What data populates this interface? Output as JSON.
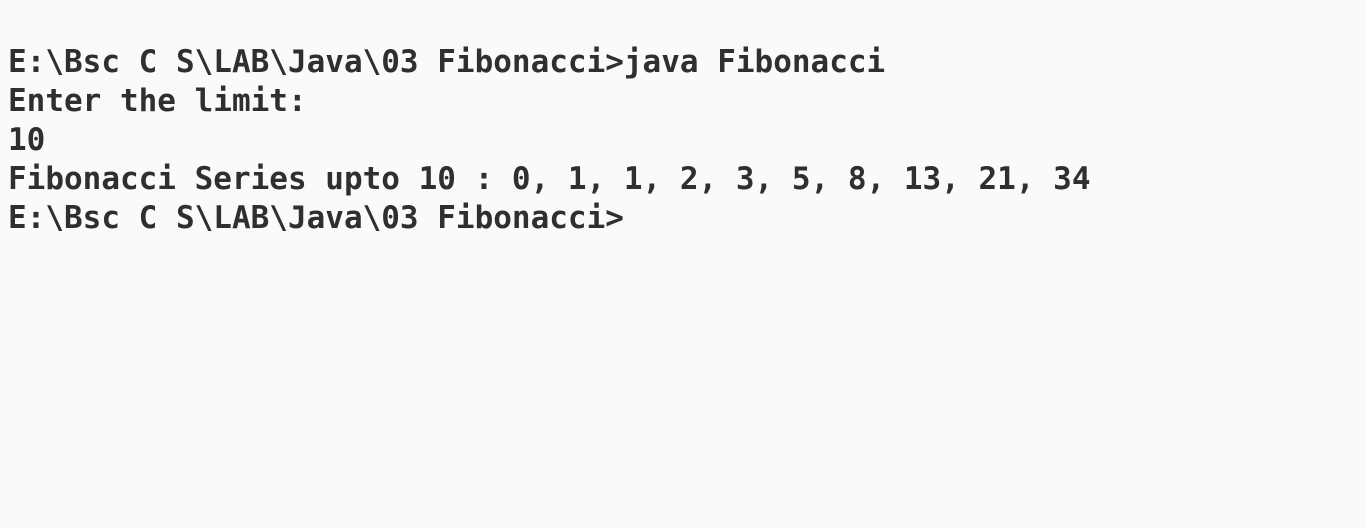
{
  "terminal": {
    "lines": [
      "E:\\Bsc C S\\LAB\\Java\\03 Fibonacci>java Fibonacci",
      "Enter the limit:",
      "10",
      "Fibonacci Series upto 10 : 0, 1, 1, 2, 3, 5, 8, 13, 21, 34",
      "E:\\Bsc C S\\LAB\\Java\\03 Fibonacci>"
    ]
  }
}
